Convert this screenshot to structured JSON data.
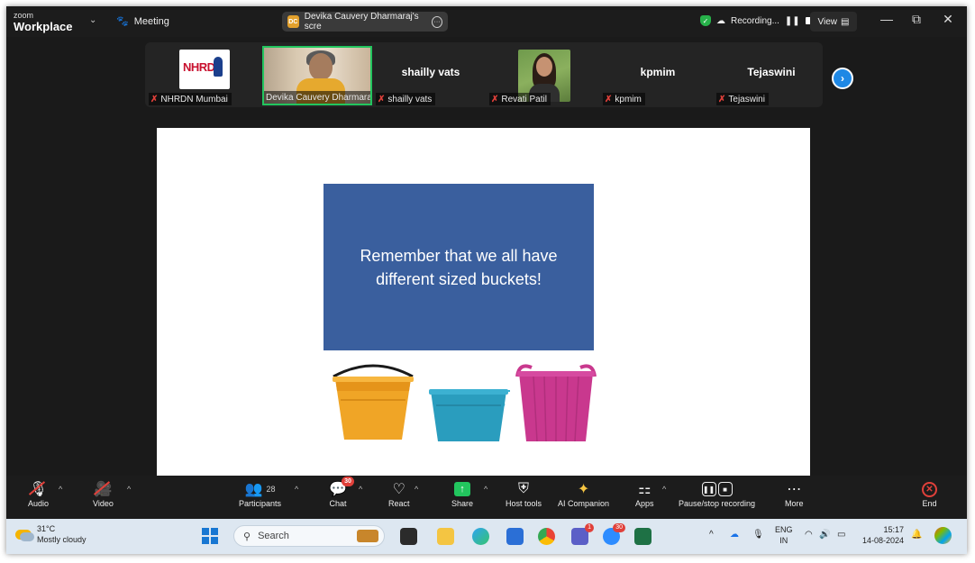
{
  "titlebar": {
    "brand_top": "zoom",
    "brand_main": "Workplace",
    "meeting_label": "Meeting",
    "share_badge": "DC",
    "share_title": "Devika Cauvery Dharmaraj's scre",
    "recording_label": "Recording...",
    "view_label": "View"
  },
  "gallery": {
    "participants": [
      {
        "name": "NHRDN Mumbai",
        "display": "",
        "logo_text": "NHRD"
      },
      {
        "name": "Devika Cauvery Dharmaraj",
        "display": ""
      },
      {
        "name": "shailly vats",
        "display": "shailly vats"
      },
      {
        "name": "Revati Patil",
        "display": ""
      },
      {
        "name": "kpmim",
        "display": "kpmim"
      },
      {
        "name": "Tejaswini",
        "display": "Tejaswini"
      }
    ]
  },
  "slide": {
    "text": "Remember that we all have different sized buckets!",
    "buckets": [
      {
        "color": "#f0a526",
        "rim": "#e5941a"
      },
      {
        "color": "#2a9dbe",
        "rim": "#3cb1d2"
      },
      {
        "color": "#c9388e",
        "rim": "#d64aa0"
      }
    ]
  },
  "toolbar": {
    "audio": "Audio",
    "video": "Video",
    "participants": "Participants",
    "participants_count": "28",
    "chat": "Chat",
    "chat_badge": "30",
    "react": "React",
    "share": "Share",
    "host_tools": "Host tools",
    "ai_companion": "AI Companion",
    "apps": "Apps",
    "pause_stop": "Pause/stop recording",
    "more": "More",
    "end": "End"
  },
  "taskbar": {
    "temperature": "31°C",
    "weather": "Mostly cloudy",
    "search_placeholder": "Search",
    "teams_badge": "1",
    "zoom_badge": "30",
    "lang_top": "ENG",
    "lang_bottom": "IN",
    "time": "15:17",
    "date": "14-08-2024"
  },
  "colors": {
    "accent_green": "#22c55e",
    "mute_red": "#e0403a",
    "slide_blue": "#3a5f9e",
    "next_blue": "#1e88e5"
  }
}
